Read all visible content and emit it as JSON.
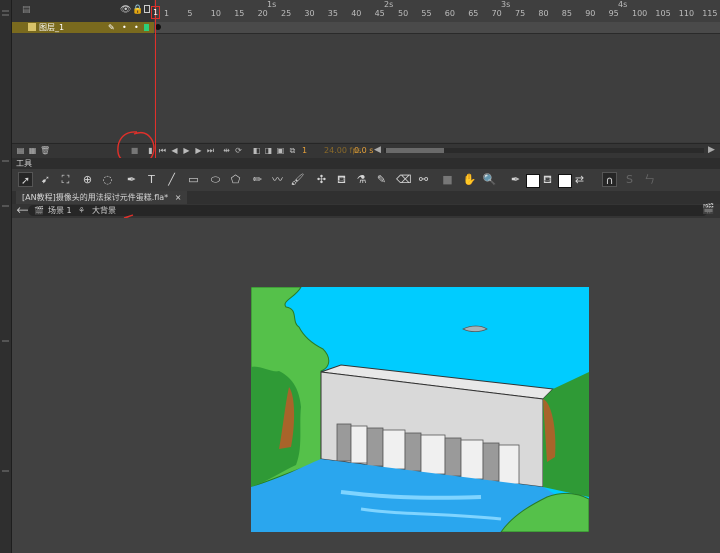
{
  "timeline": {
    "layer_name": "图层_1",
    "ruler_numbers": [
      "1",
      "5",
      "10",
      "15",
      "20",
      "25",
      "30",
      "35",
      "40",
      "45",
      "50",
      "55",
      "60",
      "65",
      "70",
      "75",
      "80",
      "85",
      "90",
      "95",
      "100",
      "105",
      "110",
      "115"
    ],
    "ruler_seconds": [
      "1s",
      "2s",
      "3s",
      "4s"
    ],
    "playhead_frame": "1",
    "footer": {
      "current_frame": "1",
      "fps": "24.00 fps",
      "elapsed": "0.0 s"
    }
  },
  "tools_panel": {
    "title": "工具"
  },
  "document": {
    "tab_title": "[AN教程]摄像头的用法探讨元件蛋糕.fla*",
    "tab_close": "×"
  },
  "breadcrumb": {
    "scene": "场景 1",
    "symbol": "大背景"
  },
  "colors": {
    "playhead": "#e0302a",
    "layer_highlight": "#7a6a1e",
    "sky": "#00ccff",
    "grass": "#55c14a",
    "dark_grass": "#2f9a36",
    "water": "#2aa6ee",
    "dam_wall": "#d9d9d9",
    "cliff": "#a8642a"
  }
}
